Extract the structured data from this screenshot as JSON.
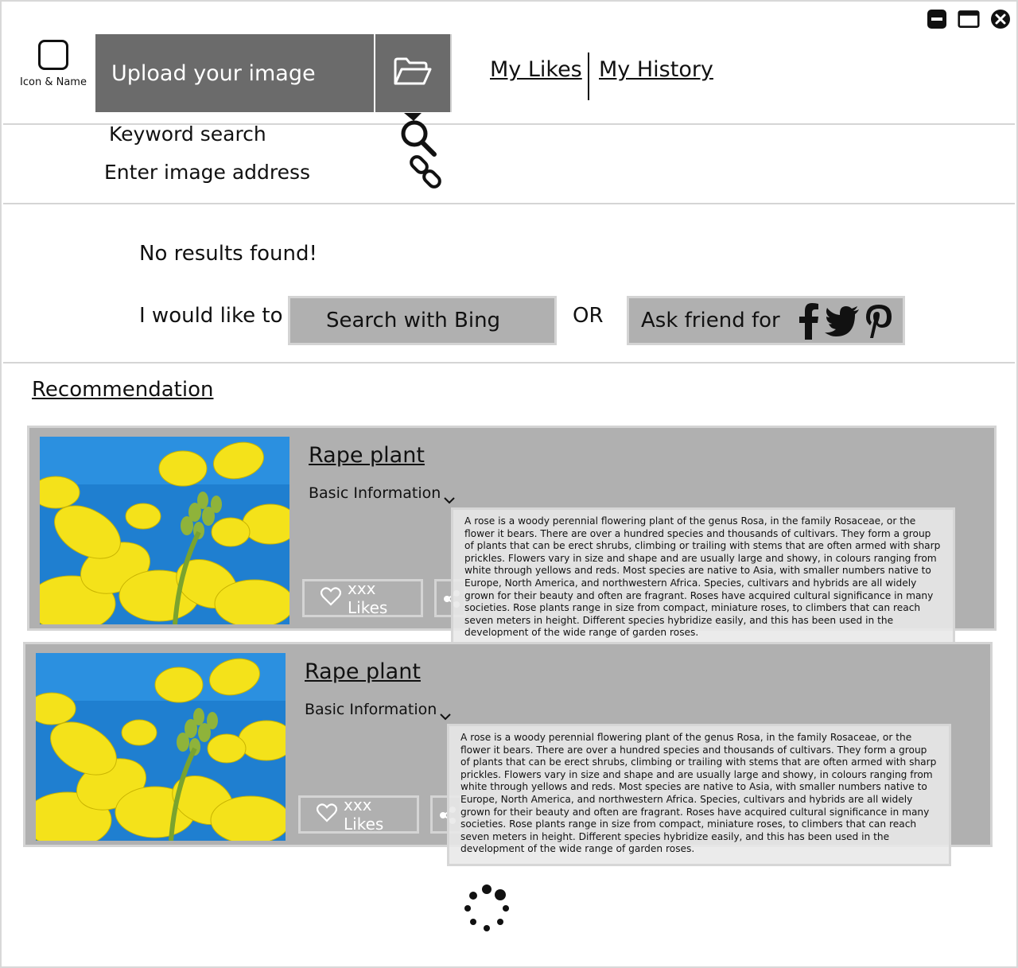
{
  "header": {
    "logo_label": "Icon & Name",
    "upload_label": "Upload your image",
    "nav": {
      "likes": "My Likes",
      "history": "My History"
    }
  },
  "search": {
    "keyword": "Keyword search",
    "image_address": "Enter image address"
  },
  "results": {
    "message": "No results found!",
    "prompt": "I would like to",
    "bing_button": "Search with Bing",
    "or": "OR",
    "friend_button": "Ask friend for"
  },
  "recommendation": {
    "title": "Recommendation",
    "cards": [
      {
        "title": "Rape plant",
        "basic": "Basic Information",
        "likes": "xxx Likes",
        "description": "A rose is a woody perennial flowering plant of the genus Rosa, in the family Rosaceae, or the flower it bears. There are over a hundred species and thousands of cultivars. They form a group of plants that can be erect shrubs, climbing or trailing with stems that are often armed with sharp prickles. Flowers vary in size and shape and are usually large and showy, in colours ranging from white through yellows and reds. Most species are native to Asia, with smaller numbers native to Europe, North America, and northwestern Africa. Species, cultivars and hybrids are all widely grown for their beauty and often are fragrant. Roses have acquired cultural significance in many societies. Rose plants range in size from compact, miniature roses, to climbers that can reach seven meters in height. Different species hybridize easily, and this has been used in the development of the wide range of garden roses."
      },
      {
        "title": "Rape plant",
        "basic": "Basic Information",
        "likes": "xxx Likes",
        "description": "A rose is a woody perennial flowering plant of the genus Rosa, in the family Rosaceae, or the flower it bears. There are over a hundred species and thousands of cultivars. They form a group of plants that can be erect shrubs, climbing or trailing with stems that are often armed with sharp prickles. Flowers vary in size and shape and are usually large and showy, in colours ranging from white through yellows and reds. Most species are native to Asia, with smaller numbers native to Europe, North America, and northwestern Africa. Species, cultivars and hybrids are all widely grown for their beauty and often are fragrant. Roses have acquired cultural significance in many societies. Rose plants range in size from compact, miniature roses, to climbers that can reach seven meters in height. Different species hybridize easily, and this has been used in the development of the wide range of garden roses."
      }
    ]
  },
  "icons": {
    "window": [
      "minimize-icon",
      "maximize-icon",
      "close-icon"
    ],
    "upload": "folder-open-icon",
    "search": "search-icon",
    "link": "link-icon",
    "social": [
      "facebook-icon",
      "twitter-icon",
      "pinterest-icon"
    ],
    "like": "heart-icon",
    "share": "share-icon",
    "loading": "loading-spinner-icon"
  },
  "colors": {
    "dark_button": "#6b6b6b",
    "card": "#b0b0b0",
    "sky": "#1f7fd0",
    "flower": "#f4e21a"
  }
}
